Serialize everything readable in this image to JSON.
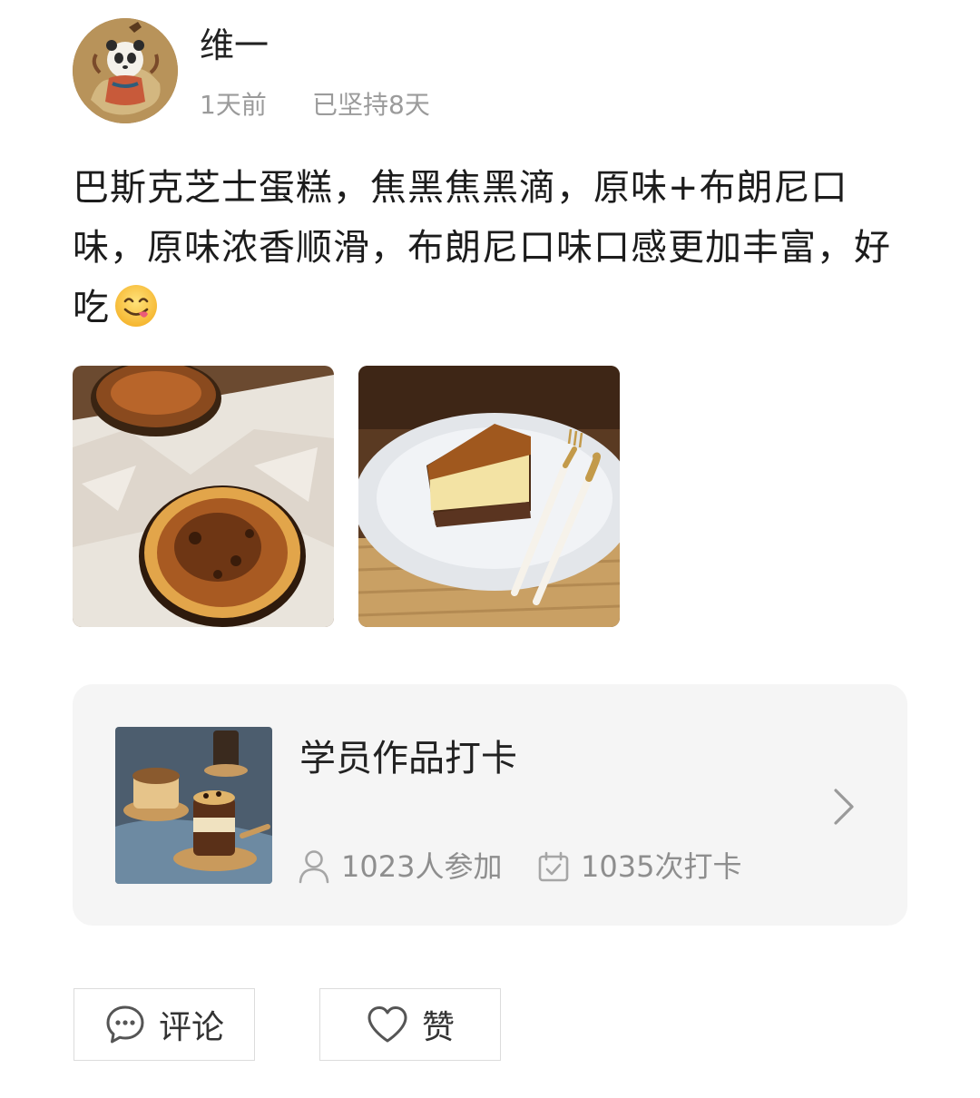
{
  "post": {
    "author": {
      "name": "维一",
      "time_ago": "1天前",
      "streak": "已坚持8天"
    },
    "text": "巴斯克芝士蛋糕，焦黑焦黑滴，原味+布朗尼口味，原味浓香顺滑，布朗尼口味口感更加丰富，好吃",
    "emoji": "smiling-face-savoring-food-icon",
    "photos": [
      {
        "name": "basque-cheesecakes-on-parchment"
      },
      {
        "name": "cheesecake-slice-on-plate"
      }
    ]
  },
  "topic_card": {
    "title": "学员作品打卡",
    "members": "1023人参加",
    "checkins": "1035次打卡",
    "member_icon": "person-icon",
    "checkin_icon": "calendar-check-icon",
    "chevron_icon": "chevron-right-icon"
  },
  "actions": {
    "comment_label": "评论",
    "like_label": "赞",
    "comment_icon": "comment-bubble-icon",
    "like_icon": "heart-outline-icon"
  },
  "colors": {
    "primary_text": "#222222",
    "secondary_text": "#9b9b9b",
    "card_background": "#f5f5f5",
    "border": "#dcdcdc"
  }
}
